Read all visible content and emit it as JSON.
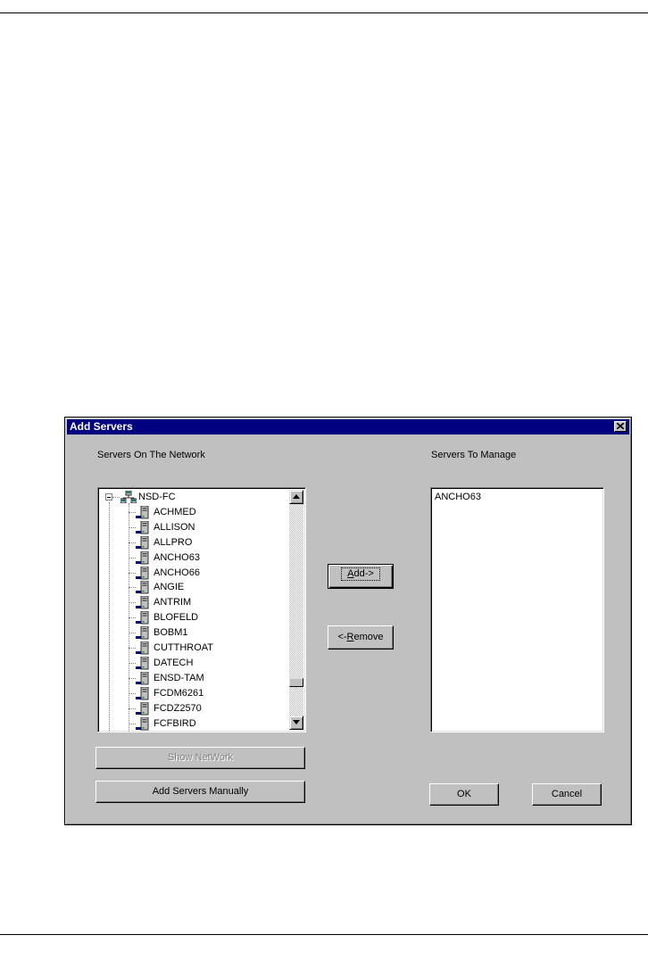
{
  "dialog": {
    "title": "Add Servers",
    "left_panel_label": "Servers On The Network",
    "right_panel_label": "Servers To Manage",
    "tree": {
      "root": "NSD-FC",
      "servers": [
        "ACHMED",
        "ALLISON",
        "ALLPRO",
        "ANCHO63",
        "ANCHO66",
        "ANGIE",
        "ANTRIM",
        "BLOFELD",
        "BOBM1",
        "CUTTHROAT",
        "DATECH",
        "ENSD-TAM",
        "FCDM6261",
        "FCDZ2570",
        "FCFBIRD"
      ],
      "scroll_position": 0.85
    },
    "managed_servers": [
      "ANCHO63"
    ],
    "buttons": {
      "add_mnemonic": "A",
      "add_rest": "dd->",
      "remove_prefix": "<-",
      "remove_mnemonic": "R",
      "remove_rest": "emove",
      "show_network": "Show NetWork",
      "add_manually": "Add Servers Manually",
      "ok": "OK",
      "cancel": "Cancel"
    },
    "icons": {
      "close": "close-icon",
      "network": "network-icon",
      "server": "server-icon",
      "scroll_up": "arrow-up-icon",
      "scroll_down": "arrow-down-icon"
    }
  }
}
